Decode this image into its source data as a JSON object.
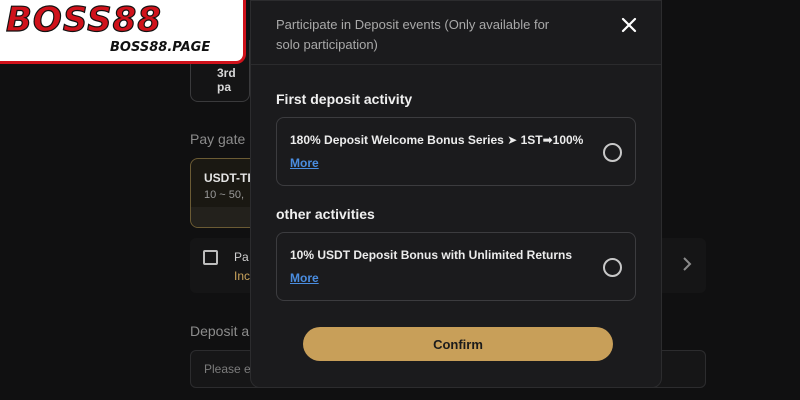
{
  "logo": {
    "main": "BOSS88",
    "sub": "BOSS88.PAGE"
  },
  "background": {
    "card_fragment": "3rd pa",
    "pay_gate_label": "Pay gate",
    "gate_name": "USDT-TR",
    "gate_range": "10 ~ 50,",
    "promo_line1": "Pa",
    "promo_line2": "Inc",
    "deposit_label": "Deposit a",
    "deposit_placeholder": "Please e"
  },
  "modal": {
    "title": "Participate in Deposit events (Only available for solo participation)",
    "sections": [
      {
        "title": "First deposit activity",
        "event": {
          "name": "180% Deposit Welcome Bonus Series ➤ 1ST➡100%",
          "more": "More",
          "selected": false
        }
      },
      {
        "title": "other activities",
        "event": {
          "name": "10% USDT Deposit Bonus with Unlimited Returns",
          "more": "More",
          "selected": false
        }
      }
    ],
    "confirm_label": "Confirm"
  },
  "icons": [
    "close-icon",
    "chevron-right-icon"
  ],
  "colors": {
    "accent": "#c89f59",
    "link": "#4a8de0",
    "brand_red": "#d0121b"
  }
}
